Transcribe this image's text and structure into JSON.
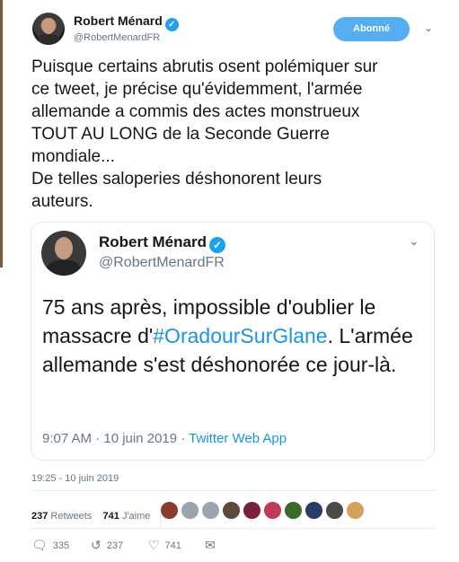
{
  "author": {
    "name": "Robert Ménard",
    "handle": "@RobertMenardFR",
    "verified_glyph": "✓"
  },
  "follow_button_label": "Abonné",
  "menu_chevron": "⌄",
  "tweet_text_lines": [
    "Puisque certains abrutis osent polémiquer sur",
    "ce tweet, je précise qu'évidemment, l'armée",
    "allemande a commis des actes monstrueux",
    "TOUT AU LONG de la Seconde Guerre",
    "mondiale...",
    "De telles saloperies déshonorent leurs",
    "auteurs."
  ],
  "quoted": {
    "name": "Robert Ménard",
    "handle": "@RobertMenardFR",
    "text_before": "75 ans après, impossible d'oublier le massacre d'",
    "hashtag": "#OradourSurGlane",
    "text_after": ". L'armée allemande s'est déshonorée ce jour-là.",
    "time": "9:07 AM · 10 juin 2019 · ",
    "app": "Twitter Web App"
  },
  "timestamp": "19:25 - 10 juin 2019",
  "stats": {
    "retweets_count": "237",
    "retweets_label": "Retweets",
    "likes_count": "741",
    "likes_label": "J'aime"
  },
  "likers_colors": [
    "#8a3b2a",
    "#9aa5b0",
    "#9aa5b0",
    "#5d4a3a",
    "#7a1f3d",
    "#c23a5a",
    "#3a6a2a",
    "#2a3a6a",
    "#4a4a4a",
    "#d4a05a"
  ],
  "actions": {
    "reply_icon": "reply-icon",
    "reply_count": "335",
    "retweet_icon": "retweet-icon",
    "retweet_count": "237",
    "like_icon": "heart-icon",
    "like_count": "741",
    "dm_icon": "envelope-icon"
  },
  "colors": {
    "accent": "#1da1f2",
    "link": "#1b95e0",
    "follow_bg": "#55aef2",
    "muted": "#657786"
  }
}
